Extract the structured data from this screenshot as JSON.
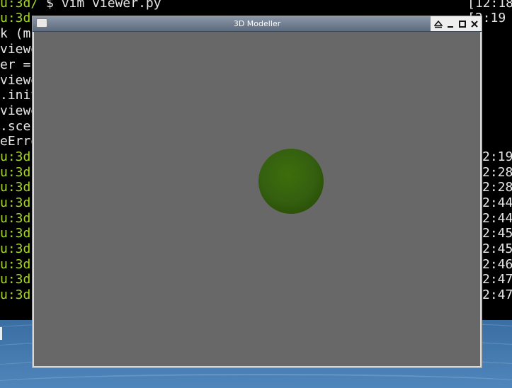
{
  "window": {
    "title": "3D Modeller",
    "controls": [
      "shade-icon",
      "minimize-icon",
      "maximize-icon",
      "close-icon"
    ]
  },
  "viewport": {
    "background": "#686868",
    "sphere_color": "#346010"
  },
  "terminal": {
    "lines": [
      {
        "a": "u:3d/",
        "b": " $ vim viewer.py"
      },
      {
        "a": "u:3d",
        "b": ""
      },
      {
        "a": "",
        "b": "k (m"
      },
      {
        "a": "",
        "b": "viewe"
      },
      {
        "a": "",
        "b": "er ="
      },
      {
        "a": "",
        "b": "viewe"
      },
      {
        "a": "",
        "b": ".init"
      },
      {
        "a": "",
        "b": "viewe"
      },
      {
        "a": "",
        "b": ".scen"
      },
      {
        "a": "",
        "b": "eErro"
      },
      {
        "a": "u:3d",
        "b": ""
      },
      {
        "a": "u:3d",
        "b": ""
      },
      {
        "a": "u:3d",
        "b": ""
      },
      {
        "a": "u:3d",
        "b": ""
      },
      {
        "a": "u:3d",
        "b": ""
      },
      {
        "a": "u:3d",
        "b": ""
      },
      {
        "a": "u:3d",
        "b": ""
      },
      {
        "a": "u:3d",
        "b": ""
      },
      {
        "a": "u:3d",
        "b": ""
      },
      {
        "a": "u:3d",
        "b": ""
      }
    ],
    "right": [
      "[12:18",
      "[2:19",
      "",
      "",
      "",
      "",
      "",
      "",
      "",
      "",
      "2:19",
      "2:28",
      "2:28",
      "2:44",
      "2:44",
      "2:45",
      "2:45",
      "2:46",
      "2:47",
      "2:47"
    ]
  }
}
